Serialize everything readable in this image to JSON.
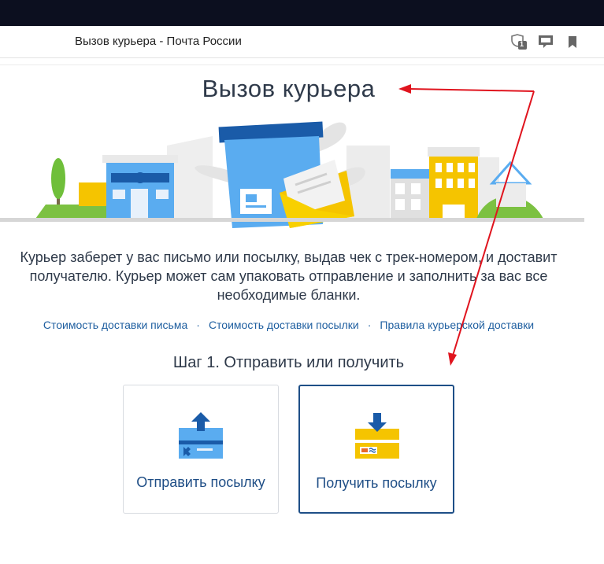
{
  "browser": {
    "tab_title": "Вызов курьера - Почта России",
    "toolbar_icons": [
      "shield-counter-icon",
      "chat-icon",
      "bookmark-icon"
    ],
    "shield_counter": "1"
  },
  "page": {
    "title": "Вызов курьера",
    "description": "Курьер заберет у вас письмо или посылку, выдав чек с трек-номером, и доставит получателю. Курьер может сам упаковать отправление и заполнить за вас все необходимые бланки.",
    "links": [
      {
        "label": "Стоимость доставки письма"
      },
      {
        "label": "Стоимость доставки посылки"
      },
      {
        "label": "Правила курьерской доставки"
      }
    ],
    "link_separator": "·",
    "step_title": "Шаг 1. Отправить или получить",
    "options": [
      {
        "label": "Отправить посылку",
        "icon": "send-parcel-icon"
      },
      {
        "label": "Получить посылку",
        "icon": "receive-parcel-icon"
      }
    ]
  },
  "colors": {
    "accent_blue": "#1e4f87",
    "link_blue": "#1f5fa0",
    "annotation_red": "#e0141e",
    "yellow": "#f5c400",
    "light_blue": "#5aacf0"
  }
}
